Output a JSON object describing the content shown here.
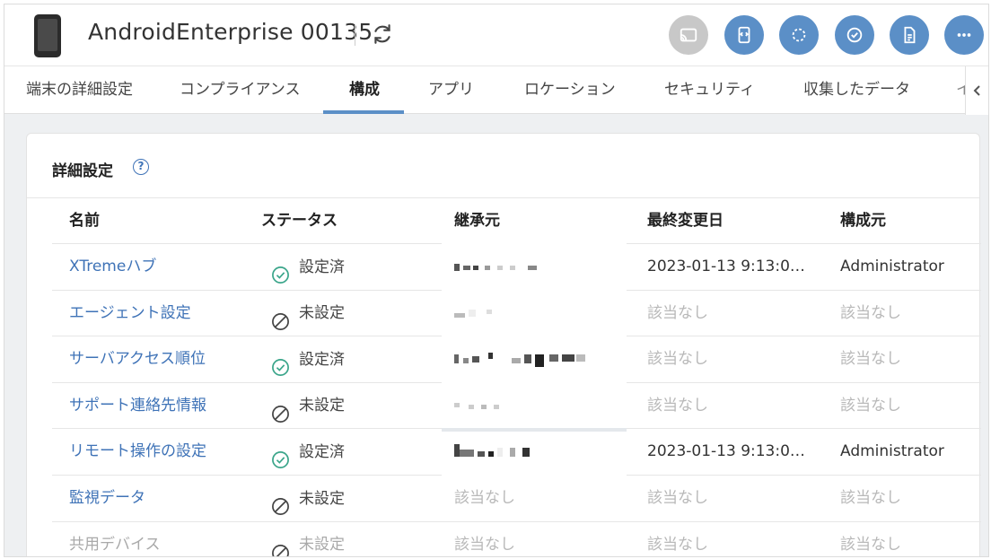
{
  "header": {
    "device_name": "AndroidEnterprise 00135"
  },
  "actions": [
    {
      "icon": "cast-icon",
      "enabled": false
    },
    {
      "icon": "remote-control-icon",
      "enabled": true
    },
    {
      "icon": "sync-icon",
      "enabled": true
    },
    {
      "icon": "check-compliance-icon",
      "enabled": true
    },
    {
      "icon": "document-icon",
      "enabled": true
    },
    {
      "icon": "more-icon",
      "enabled": true
    }
  ],
  "tabs": [
    {
      "label": "端末の詳細設定"
    },
    {
      "label": "コンプライアンス"
    },
    {
      "label": "構成",
      "active": true
    },
    {
      "label": "アプリ"
    },
    {
      "label": "ロケーション"
    },
    {
      "label": "セキュリティ"
    },
    {
      "label": "収集したデータ"
    },
    {
      "label": "イ"
    }
  ],
  "card": {
    "title": "詳細設定",
    "columns": {
      "name": "名前",
      "status": "ステータス",
      "inherit": "継承元",
      "modified": "最終変更日",
      "origin": "構成元"
    },
    "rows": [
      {
        "name": "XTremeハブ",
        "status": "設定済",
        "status_type": "set",
        "modified": "2023-01-13 9:13:0…",
        "origin": "Administrator"
      },
      {
        "name": "エージェント設定",
        "status": "未設定",
        "status_type": "unset",
        "modified": "該当なし",
        "origin": "該当なし"
      },
      {
        "name": "サーバアクセス順位",
        "status": "設定済",
        "status_type": "set",
        "modified": "該当なし",
        "origin": "該当なし"
      },
      {
        "name": "サポート連絡先情報",
        "status": "未設定",
        "status_type": "unset",
        "modified": "該当なし",
        "origin": "該当なし"
      },
      {
        "name": "リモート操作の設定",
        "status": "設定済",
        "status_type": "set",
        "modified": "2023-01-13 9:13:0…",
        "origin": "Administrator"
      },
      {
        "name": "監視データ",
        "status": "未設定",
        "status_type": "unset",
        "inherit": "該当なし",
        "modified": "該当なし",
        "origin": "該当なし"
      },
      {
        "name": "共用デバイス",
        "status": "未設定",
        "status_type": "unset",
        "inherit": "該当なし",
        "modified": "該当なし",
        "origin": "該当なし",
        "disabled": true
      }
    ]
  },
  "colors": {
    "accent": "#5b8fc7",
    "link": "#3f73b7",
    "check_green": "#3aa58a",
    "muted": "#b8b8b8"
  }
}
